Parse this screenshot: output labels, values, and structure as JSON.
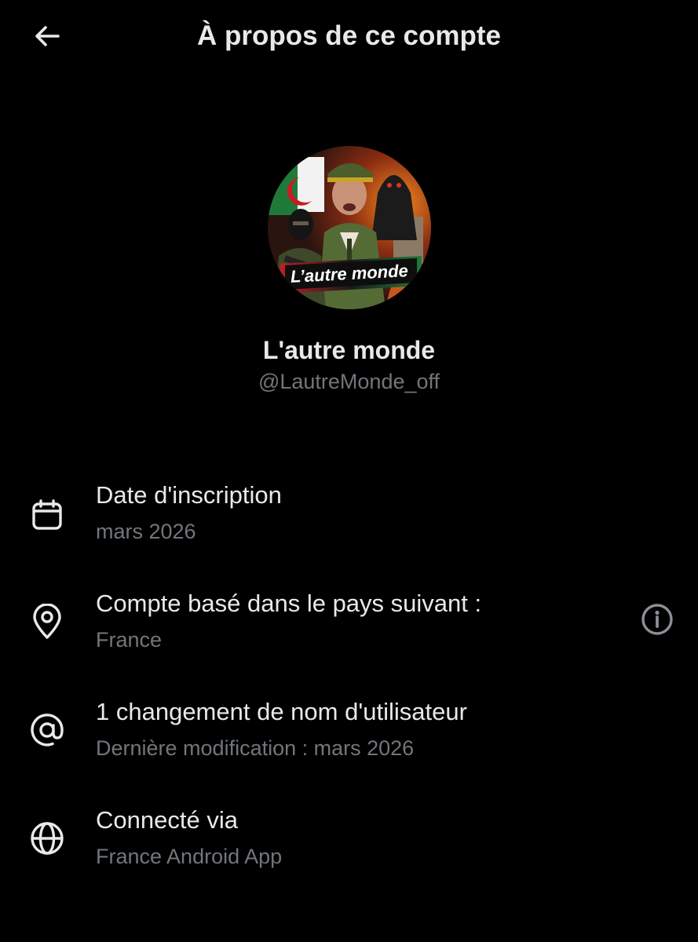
{
  "header": {
    "title": "À propos de ce compte",
    "back_icon": "arrow-left-icon"
  },
  "profile": {
    "avatar_caption": "L’autre monde",
    "display_name": "L'autre monde",
    "handle": "@LautreMonde_off"
  },
  "info": [
    {
      "icon": "calendar-icon",
      "title": "Date d'inscription",
      "subtitle": "mars 2026"
    },
    {
      "icon": "location-pin-icon",
      "title": "Compte basé dans le pays suivant :",
      "subtitle": "France",
      "action_icon": "info-icon"
    },
    {
      "icon": "at-sign-icon",
      "title": "1 changement de nom d'utilisateur",
      "subtitle": "Dernière modification : mars 2026"
    },
    {
      "icon": "globe-icon",
      "title": "Connecté via",
      "subtitle": "France Android App"
    }
  ],
  "colors": {
    "background": "#000000",
    "primary_text": "#e7e9ea",
    "secondary_text": "#71767b"
  }
}
